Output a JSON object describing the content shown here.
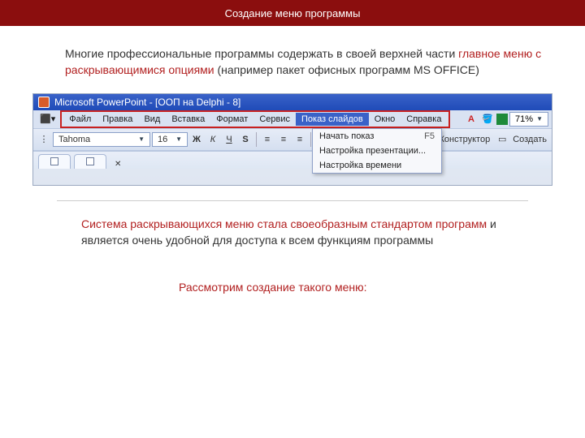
{
  "header": {
    "title": "Создание меню программы"
  },
  "para1": {
    "t1": "Многие профессиональные программы содержать в своей верхней части ",
    "accent": "главное меню с раскрывающимися опциями",
    "t2": " (например пакет офисных программ MS OFFICE)"
  },
  "screenshot": {
    "titlebar": "Microsoft PowerPoint - [ООП на Delphi - 8]",
    "menu": {
      "items": [
        "Файл",
        "Правка",
        "Вид",
        "Вставка",
        "Формат",
        "Сервис",
        "Показ слайдов",
        "Окно",
        "Справка"
      ]
    },
    "dropdown": [
      {
        "label": "Начать показ",
        "shortcut": "F5"
      },
      {
        "label": "Настройка презентации...",
        "shortcut": ""
      },
      {
        "label": "Настройка времени",
        "shortcut": ""
      }
    ],
    "toolbar": {
      "font": "Tahoma",
      "size": "16",
      "bold": "Ж",
      "italic": "К",
      "underline": "Ч",
      "shadow": "S",
      "fontlabel": "A",
      "zoom": "71%",
      "designer": "Конструктор",
      "create": "Создать"
    }
  },
  "para2": {
    "accent": "Система раскрывающихся меню стала своеобразным стандартом программ",
    "t1": " и является очень удобной для доступа к всем функциям программы"
  },
  "para3": {
    "text": "Рассмотрим создание такого меню:"
  }
}
